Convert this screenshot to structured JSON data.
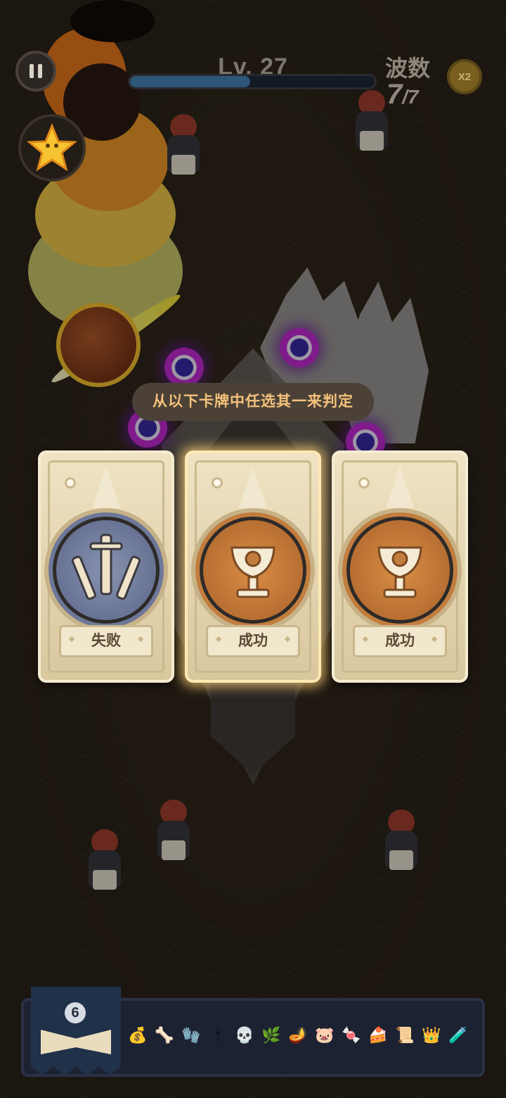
{
  "hud": {
    "level_label": "Lv. 27",
    "xp_progress": 0.49,
    "wave_title": "波数",
    "wave_current": "7",
    "wave_total": "/7",
    "speed_label": "X2"
  },
  "dialog": {
    "prompt": "从以下卡牌中任选其一来判定",
    "cards": [
      {
        "label": "失败",
        "icon": "swords-icon",
        "selected": false
      },
      {
        "label": "成功",
        "icon": "trophy-icon",
        "selected": true
      },
      {
        "label": "成功",
        "icon": "trophy-icon",
        "selected": false
      }
    ]
  },
  "bottom_bar": {
    "book_count": "6",
    "items": [
      {
        "icon": "money-bag-icon",
        "glyph": "💰"
      },
      {
        "icon": "horn-icon",
        "glyph": "🦴"
      },
      {
        "icon": "gauntlet-icon",
        "glyph": "🧤"
      },
      {
        "icon": "candle-icon",
        "glyph": "🕯"
      },
      {
        "icon": "skull-icon",
        "glyph": "💀"
      },
      {
        "icon": "leaf-icon",
        "glyph": "🌿"
      },
      {
        "icon": "lamp-icon",
        "glyph": "🪔"
      },
      {
        "icon": "piggy-bank-icon",
        "glyph": "🐷"
      },
      {
        "icon": "candy-icon",
        "glyph": "🍬"
      },
      {
        "icon": "cake-icon",
        "glyph": "🍰"
      },
      {
        "icon": "scroll-icon",
        "glyph": "📜"
      },
      {
        "icon": "crown-icon",
        "glyph": "👑"
      },
      {
        "icon": "potion-icon",
        "glyph": "🧪"
      }
    ]
  },
  "colors": {
    "prompt_text": "#f4c27b",
    "card_fail": "#6d7899",
    "card_success": "#c27d3e"
  }
}
